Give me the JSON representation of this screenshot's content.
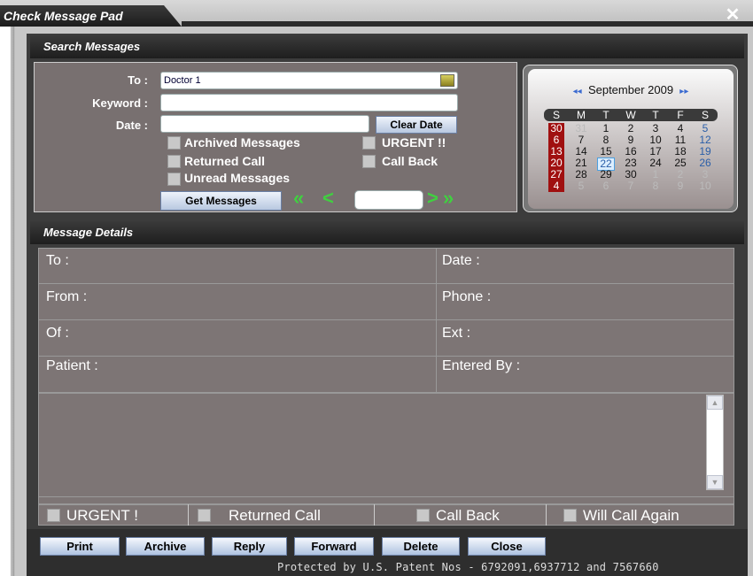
{
  "window": {
    "title": "Check Message Pad",
    "close_glyph": "✕"
  },
  "search": {
    "header": "Search Messages",
    "to_label": "To :",
    "to_value": "Doctor 1",
    "keyword_label": "Keyword :",
    "keyword_value": "",
    "date_label": "Date :",
    "date_value": "",
    "clear_date": "Clear Date",
    "archived": "Archived Messages",
    "urgent": "URGENT !!",
    "returned": "Returned Call",
    "callback": "Call Back",
    "unread": "Unread Messages",
    "get_messages": "Get Messages",
    "page_value": ""
  },
  "calendar": {
    "month": "September 2009",
    "prev_glyph": "◂◂",
    "next_glyph": "▸▸",
    "days": [
      "S",
      "M",
      "T",
      "W",
      "T",
      "F",
      "S"
    ],
    "weeks": [
      [
        "30",
        "31",
        "1",
        "2",
        "3",
        "4",
        "5"
      ],
      [
        "6",
        "7",
        "8",
        "9",
        "10",
        "11",
        "12"
      ],
      [
        "13",
        "14",
        "15",
        "16",
        "17",
        "18",
        "19"
      ],
      [
        "20",
        "21",
        "22",
        "23",
        "24",
        "25",
        "26"
      ],
      [
        "27",
        "28",
        "29",
        "30",
        "1",
        "2",
        "3"
      ],
      [
        "4",
        "5",
        "6",
        "7",
        "8",
        "9",
        "10"
      ]
    ],
    "today": "22",
    "colors": {
      "sunday_bg": "#a01010",
      "saturday": "#2a5ea8",
      "other_month": "#bbb",
      "today_border": "#4da0e0"
    }
  },
  "details": {
    "header": "Message Details",
    "to": "To :",
    "date": "Date :",
    "from": "From :",
    "phone": "Phone :",
    "of": "Of :",
    "ext": "Ext :",
    "patient": "Patient :",
    "entered_by": "Entered By :",
    "message_body": ""
  },
  "flags": {
    "urgent": "URGENT !",
    "returned": "Returned Call",
    "callback": "Call Back",
    "will_call": "Will Call Again"
  },
  "buttons": {
    "print": "Print",
    "archive": "Archive",
    "reply": "Reply",
    "forward": "Forward",
    "delete": "Delete",
    "close": "Close"
  },
  "footer": {
    "patent": "Protected by U.S. Patent Nos - 6792091,6937712 and 7567660"
  }
}
